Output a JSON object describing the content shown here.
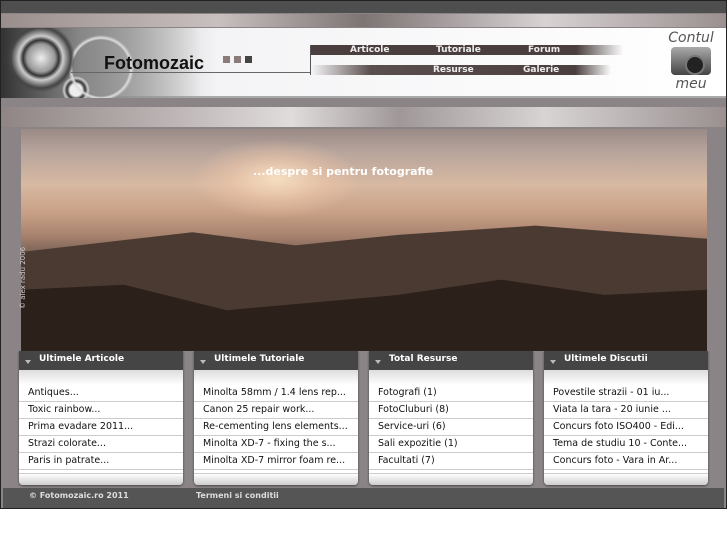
{
  "header": {
    "logo": "Fotomozaic",
    "account_line1": "Contul",
    "account_line2": "meu",
    "nav_top": [
      "Articole",
      "Tutoriale",
      "Forum"
    ],
    "nav_bottom": [
      "Resurse",
      "Galerie"
    ]
  },
  "hero": {
    "tagline": "...despre si pentru fotografie",
    "credit": "© alex radu 2006"
  },
  "panels": [
    {
      "title": "Ultimele Articole",
      "items": [
        "Antiques...",
        "Toxic rainbow...",
        "Prima evadare 2011...",
        "Strazi colorate...",
        "Paris in patrate..."
      ]
    },
    {
      "title": "Ultimele Tutoriale",
      "items": [
        "Minolta 58mm / 1.4 lens rep...",
        "Canon 25 repair work...",
        "Re-cementing lens elements...",
        "Minolta XD-7 - fixing the s...",
        "Minolta XD-7 mirror foam re..."
      ]
    },
    {
      "title": "Total Resurse",
      "items": [
        "Fotografi (1)",
        "FotoCluburi (8)",
        "Service-uri (6)",
        "Sali expozitie (1)",
        "Facultati (7)"
      ]
    },
    {
      "title": "Ultimele Discutii",
      "items": [
        "Povestile strazii - 01 iu...",
        "Viata la tara - 20 iunie ...",
        "Concurs foto ISO400 - Edi...",
        "Tema de studiu 10 - Conte...",
        "Concurs foto - Vara in Ar..."
      ]
    }
  ],
  "footer": {
    "copyright": "© Fotomozaic.ro 2011",
    "terms": "Termeni si conditii"
  }
}
